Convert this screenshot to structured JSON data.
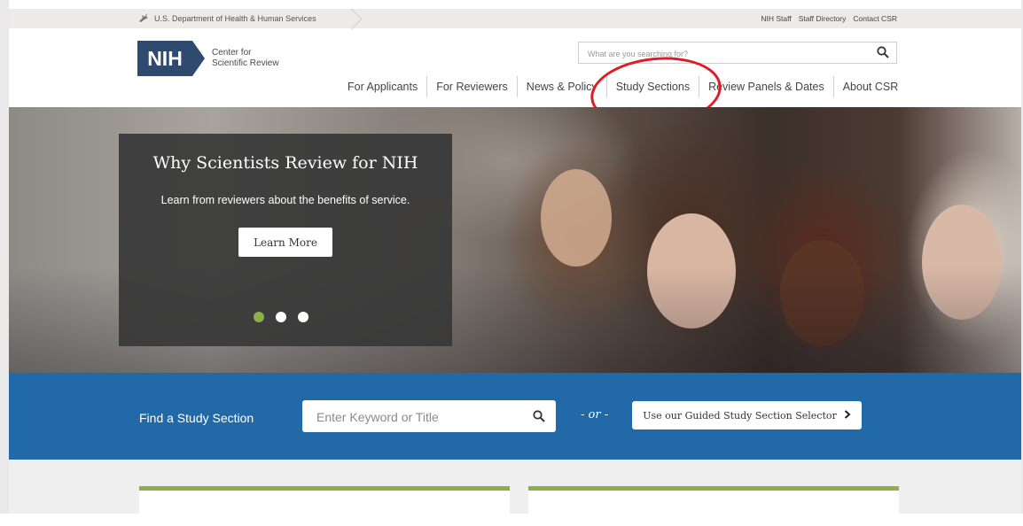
{
  "utility_bar": {
    "agency": "U.S. Department of Health & Human Services",
    "links": [
      "NIH Staff",
      "Staff Directory",
      "Contact CSR"
    ]
  },
  "header": {
    "logo_text": "NIH",
    "org_name_line1": "Center for",
    "org_name_line2": "Scientific Review",
    "search_placeholder": "What are you searching for?",
    "nav": [
      "For Applicants",
      "For Reviewers",
      "News & Policy",
      "Study Sections",
      "Review Panels & Dates",
      "About CSR"
    ]
  },
  "hero": {
    "title": "Why Scientists Review for NIH",
    "subtitle": "Learn from reviewers about the benefits of service.",
    "button": "Learn More",
    "active_slide": 1,
    "slide_count": 3
  },
  "find": {
    "label": "Find a Study Section",
    "placeholder": "Enter Keyword or Title",
    "or_text": "- or -",
    "selector_button": "Use our Guided Study Section Selector"
  },
  "colors": {
    "nih_blue": "#2e4a6f",
    "band_blue": "#2169a7",
    "accent_green": "#8bb04a",
    "annotation_red": "#e01b24"
  }
}
